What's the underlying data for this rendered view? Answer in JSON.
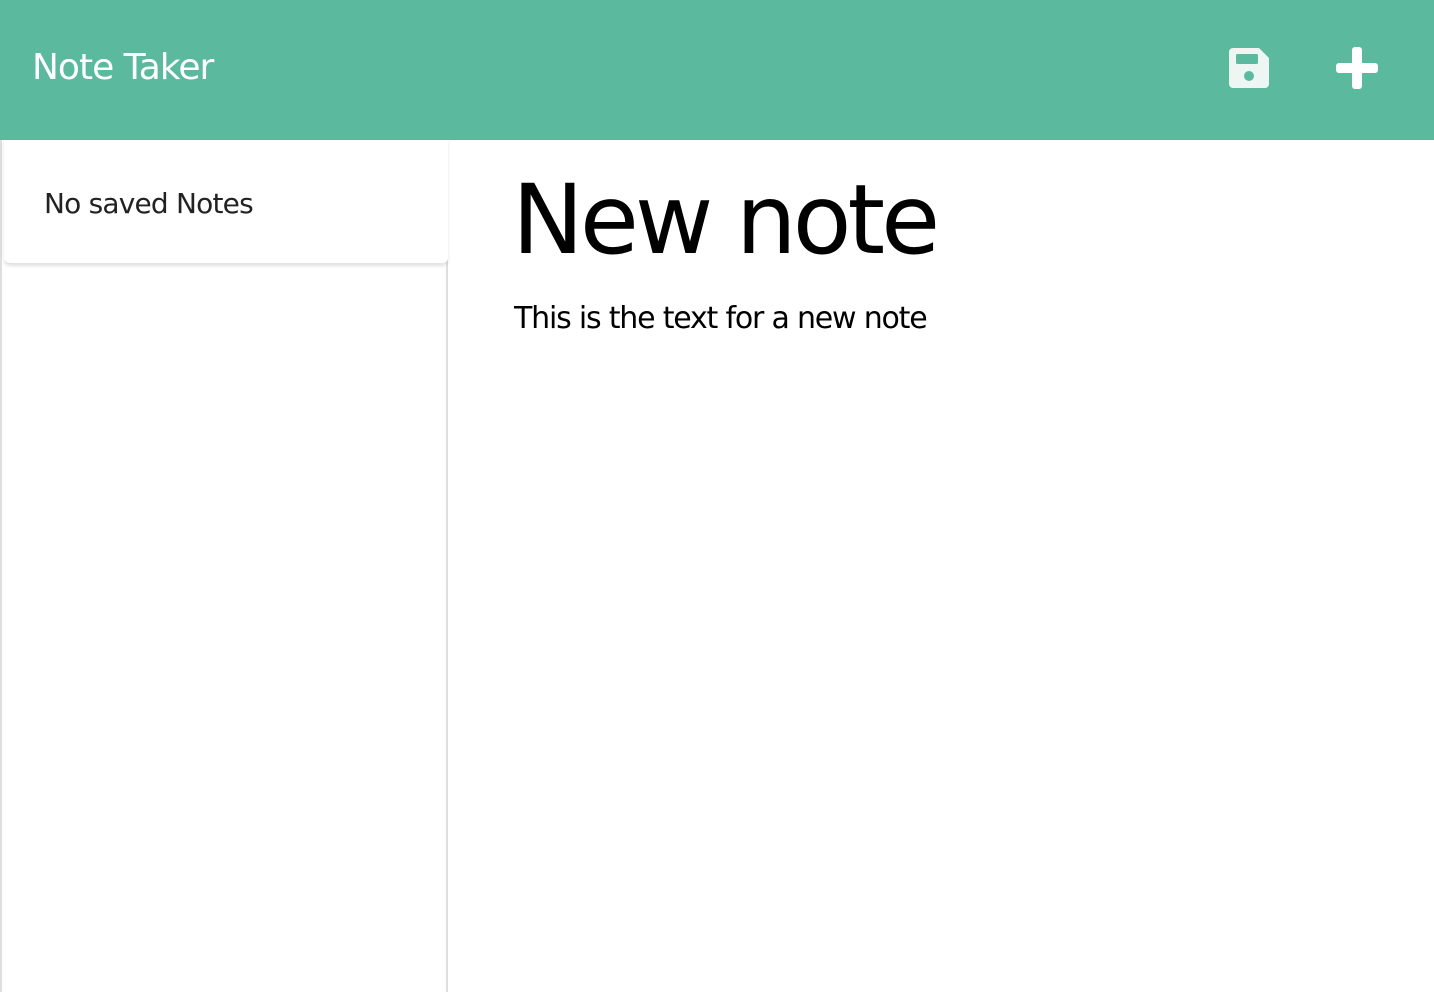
{
  "app": {
    "title": "Note Taker"
  },
  "toolbar": {
    "save_icon": "floppy-disk-icon",
    "new_icon": "plus-icon",
    "icon_color": "#ffffff"
  },
  "sidebar": {
    "empty_message": "No saved Notes"
  },
  "note": {
    "title": "New note",
    "text": "This is the text for a new note"
  },
  "colors": {
    "navbar": "#5bba9d",
    "text": "#000000"
  }
}
